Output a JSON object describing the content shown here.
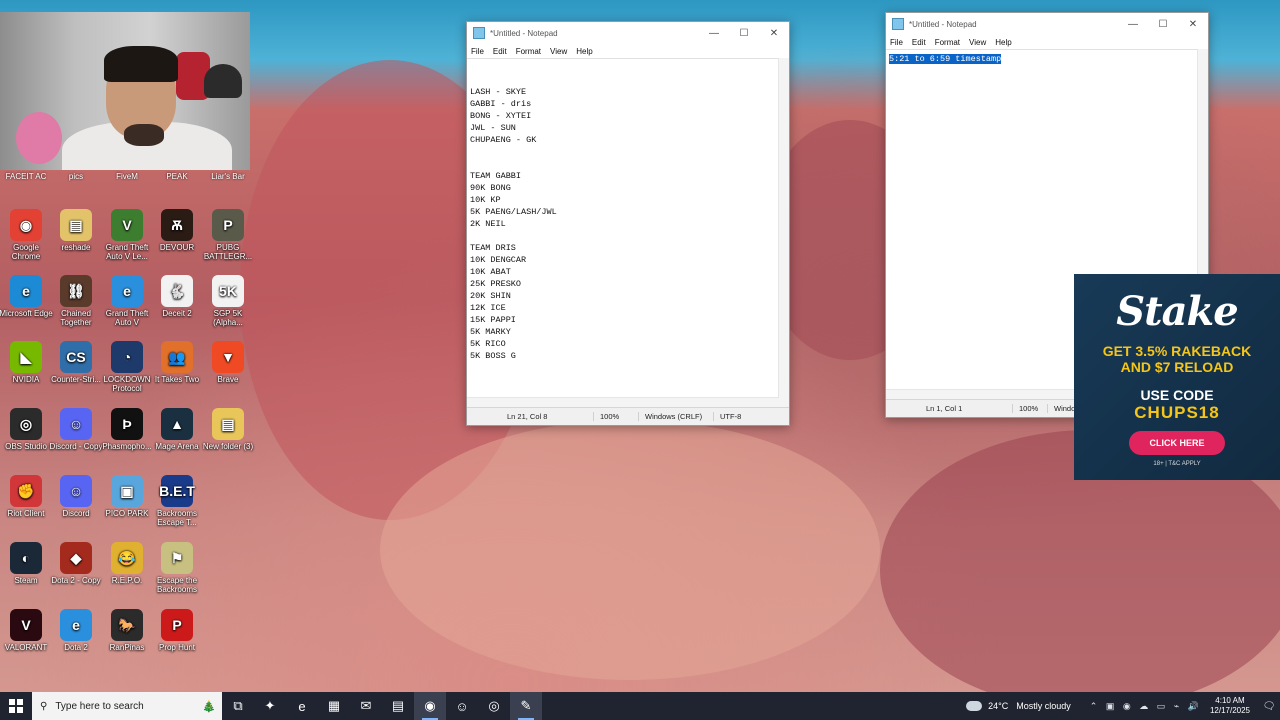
{
  "desktop": {
    "top_row": [
      "FACEIT AC",
      "pics",
      "FiveM",
      "PEAK",
      "Liar's Bar"
    ],
    "icons": [
      {
        "label": "Google Chrome",
        "icon": "chrome-icon",
        "color": "#e34133",
        "glyph": "◉"
      },
      {
        "label": "reshade",
        "icon": "folder-icon",
        "color": "#e2c36a",
        "glyph": "▤"
      },
      {
        "label": "Grand Theft Auto V Le...",
        "icon": "gta-icon",
        "color": "#3c7d2f",
        "glyph": "V"
      },
      {
        "label": "DEVOUR",
        "icon": "devour-icon",
        "color": "#2a1b14",
        "glyph": "Ѫ"
      },
      {
        "label": "PUBG BATTLEGR...",
        "icon": "pubg-icon",
        "color": "#5a5a4a",
        "glyph": "P"
      },
      {
        "label": "Microsoft Edge",
        "icon": "edge-icon",
        "color": "#1c8ad4",
        "glyph": "e"
      },
      {
        "label": "Chained Together",
        "icon": "chained-icon",
        "color": "#5a3a2a",
        "glyph": "⛓"
      },
      {
        "label": "Grand Theft Auto V",
        "icon": "ie-icon",
        "color": "#2a8fdc",
        "glyph": "e"
      },
      {
        "label": "Deceit 2",
        "icon": "deceit-icon",
        "color": "#f2f2f2",
        "glyph": "🐇"
      },
      {
        "label": "SGP 5K (Alpha...",
        "icon": "sgp-icon",
        "color": "#f2f2f2",
        "glyph": "5K"
      },
      {
        "label": "NVIDIA",
        "icon": "nvidia-icon",
        "color": "#76b900",
        "glyph": "◣"
      },
      {
        "label": "Counter-Stri...",
        "icon": "cs-icon",
        "color": "#2f6ea8",
        "glyph": "CS"
      },
      {
        "label": "LOCKDOWN Protocol",
        "icon": "lockdown-icon",
        "color": "#1d3a6a",
        "glyph": "◔"
      },
      {
        "label": "It Takes Two",
        "icon": "ittakestwo-icon",
        "color": "#e0702a",
        "glyph": "👥"
      },
      {
        "label": "Brave",
        "icon": "brave-icon",
        "color": "#ef4a23",
        "glyph": "▼"
      },
      {
        "label": "OBS Studio",
        "icon": "obs-icon",
        "color": "#2b2b2b",
        "glyph": "◎"
      },
      {
        "label": "Discord - Copy",
        "icon": "discord-icon",
        "color": "#5865f2",
        "glyph": "☺"
      },
      {
        "label": "Phasmopho...",
        "icon": "phasmophobia-icon",
        "color": "#111111",
        "glyph": "Þ"
      },
      {
        "label": "Mage Arena",
        "icon": "magearena-icon",
        "color": "#1a3040",
        "glyph": "▲"
      },
      {
        "label": "New folder (3)",
        "icon": "folder-icon",
        "color": "#e8c65a",
        "glyph": "▤"
      },
      {
        "label": "Riot Client",
        "icon": "riot-icon",
        "color": "#d13639",
        "glyph": "✊"
      },
      {
        "label": "Discord",
        "icon": "discord-icon",
        "color": "#5865f2",
        "glyph": "☺"
      },
      {
        "label": "PICO PARK",
        "icon": "picopark-icon",
        "color": "#58a6dc",
        "glyph": "▣"
      },
      {
        "label": "Backrooms Escape T...",
        "icon": "backrooms-icon",
        "color": "#1a3a8a",
        "glyph": "B.E.T"
      },
      {
        "label": "",
        "icon": "blank-icon",
        "color": "transparent",
        "glyph": ""
      },
      {
        "label": "Steam",
        "icon": "steam-icon",
        "color": "#1b2838",
        "glyph": "◐"
      },
      {
        "label": "Dota 2 - Copy",
        "icon": "dota-icon",
        "color": "#a42a1e",
        "glyph": "◆"
      },
      {
        "label": "R.E.P.O.",
        "icon": "repo-icon",
        "color": "#e0b030",
        "glyph": "😂"
      },
      {
        "label": "Escape the Backrooms",
        "icon": "escapebackrooms-icon",
        "color": "#c8c080",
        "glyph": "⚑"
      },
      {
        "label": "",
        "icon": "blank-icon",
        "color": "transparent",
        "glyph": ""
      },
      {
        "label": "VALORANT",
        "icon": "valorant-icon",
        "color": "#2a0a10",
        "glyph": "V"
      },
      {
        "label": "Dota 2",
        "icon": "ie-icon",
        "color": "#2a8fdc",
        "glyph": "e"
      },
      {
        "label": "RanPinas",
        "icon": "ranpinas-icon",
        "color": "#2b2b2b",
        "glyph": "🐎"
      },
      {
        "label": "Prop Hunt",
        "icon": "prophunt-icon",
        "color": "#cc1a1a",
        "glyph": "P"
      },
      {
        "label": "",
        "icon": "blank-icon",
        "color": "transparent",
        "glyph": ""
      }
    ]
  },
  "notepad1": {
    "title": "*Untitled - Notepad",
    "menu": [
      "File",
      "Edit",
      "Format",
      "View",
      "Help"
    ],
    "content": "\n\nLASH - SKYE\nGABBI - dris\nBONG - XYTEI\nJWL - SUN\nCHUPAENG - GK\n\n\nTEAM GABBI\n90K BONG\n10K KP\n5K PAENG/LASH/JWL\n2K NEIL\n\nTEAM DRIS\n10K DENGCAR\n10K ABAT\n25K PRESKO\n20K SHIN\n12K ICE\n15K PAPPI\n5K MARKY\n5K RICO\n5K BOSS G",
    "status": {
      "position": "Ln 21, Col 8",
      "zoom": "100%",
      "eol": "Windows (CRLF)",
      "encoding": "UTF-8"
    }
  },
  "notepad2": {
    "title": "*Untitled - Notepad",
    "menu": [
      "File",
      "Edit",
      "Format",
      "View",
      "Help"
    ],
    "content": "5:21 to 6:59 timestamp",
    "status": {
      "position": "Ln 1, Col 1",
      "zoom": "100%",
      "eol": "Windo"
    }
  },
  "ad": {
    "logo": "Stake",
    "offer_line1": "GET 3.5% RAKEBACK",
    "offer_line2": "AND $7 RELOAD",
    "use_code": "USE CODE",
    "code": "CHUPS18",
    "cta": "CLICK HERE",
    "fine_print": "18+ | T&C APPLY",
    "colors": {
      "bg": "#14304a",
      "accent": "#f5c518",
      "cta": "#e0245e"
    }
  },
  "taskbar": {
    "search_placeholder": "Type here to search",
    "apps": [
      {
        "name": "task-view-icon",
        "glyph": "⧉",
        "active": false
      },
      {
        "name": "copilot-icon",
        "glyph": "✦",
        "active": false
      },
      {
        "name": "edge-icon",
        "glyph": "e",
        "active": false
      },
      {
        "name": "store-icon",
        "glyph": "▦",
        "active": false
      },
      {
        "name": "outlook-icon",
        "glyph": "✉",
        "active": false
      },
      {
        "name": "file-explorer-icon",
        "glyph": "▤",
        "active": false
      },
      {
        "name": "chrome-icon",
        "glyph": "◉",
        "active": true
      },
      {
        "name": "discord-icon",
        "glyph": "☺",
        "active": false
      },
      {
        "name": "obs-icon",
        "glyph": "◎",
        "active": false
      },
      {
        "name": "notepad-icon",
        "glyph": "✎",
        "active": true
      }
    ],
    "weather_temp": "24°C",
    "weather_desc": "Mostly cloudy",
    "time": "4:10 AM",
    "date": "12/17/2025"
  }
}
